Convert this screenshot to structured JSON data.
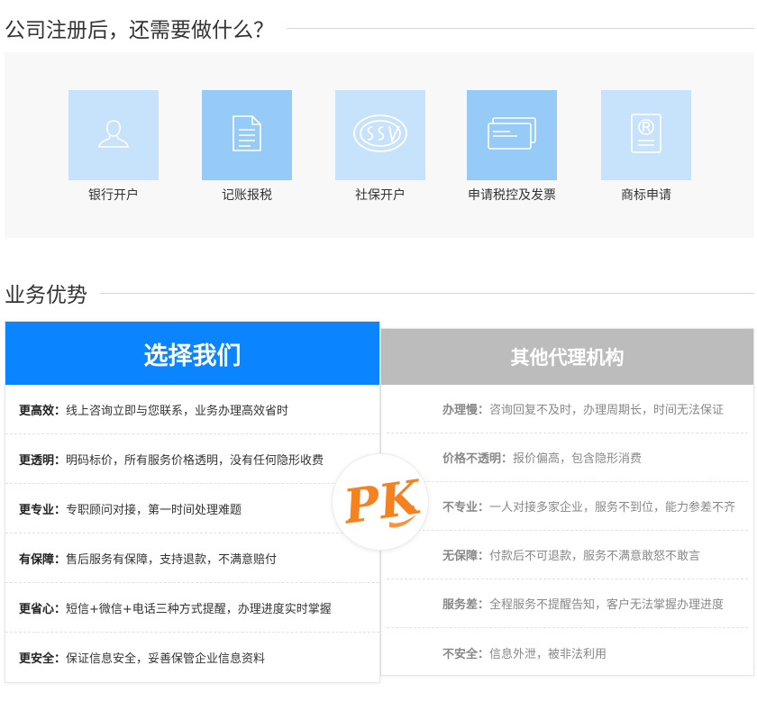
{
  "sections": {
    "services_title": "公司注册后，还需要做什么？",
    "advantages_title": "业务优势"
  },
  "services": [
    {
      "label": "银行开户",
      "icon": "user-icon"
    },
    {
      "label": "记账报税",
      "icon": "document-icon"
    },
    {
      "label": "社保开户",
      "icon": "social-security-icon"
    },
    {
      "label": "申请税控及发票",
      "icon": "cards-icon"
    },
    {
      "label": "商标申请",
      "icon": "trademark-icon"
    }
  ],
  "us": {
    "title": "选择我们",
    "rows": [
      {
        "key": "更高效：",
        "text": "线上咨询立即与您联系，业务办理高效省时"
      },
      {
        "key": "更透明：",
        "text": "明码标价，所有服务价格透明，没有任何隐形收费"
      },
      {
        "key": "更专业：",
        "text": "专职顾问对接，第一时间处理难题"
      },
      {
        "key": "有保障：",
        "text": "售后服务有保障，支持退款，不满意赔付"
      },
      {
        "key": "更省心：",
        "text": "短信+微信+电话三种方式提醒，办理进度实时掌握"
      },
      {
        "key": "更安全：",
        "text": "保证信息安全，妥善保管企业信息资料"
      }
    ]
  },
  "them": {
    "title": "其他代理机构",
    "rows": [
      {
        "key": "办理慢：",
        "text": "咨询回复不及时，办理周期长，时间无法保证"
      },
      {
        "key": "价格不透明：",
        "text": "报价偏高，包含隐形消费"
      },
      {
        "key": "不专业：",
        "text": "一人对接多家企业，服务不到位，能力参差不齐"
      },
      {
        "key": "无保障：",
        "text": "付款后不可退款，服务不满意敢怒不敢言"
      },
      {
        "key": "服务差：",
        "text": "全程服务不提醒告知，客户无法掌握办理进度"
      },
      {
        "key": "不安全：",
        "text": "信息外泄，被非法利用"
      }
    ]
  },
  "pk_badge": "PK",
  "colors": {
    "accent": "#0a84ff",
    "tile_light": "#c7e2fb",
    "tile_dark": "#96caf7",
    "other_header": "#bcbcbc",
    "pk_orange": "#f5821f"
  }
}
